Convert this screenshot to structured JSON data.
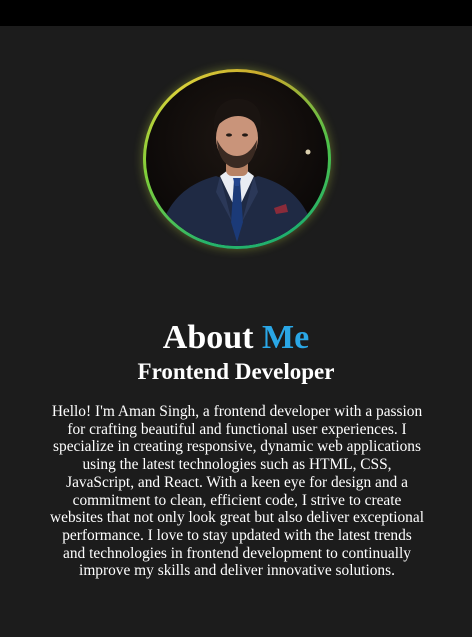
{
  "about": {
    "title_prefix": "About",
    "title_accent": "Me",
    "role": "Frontend Developer",
    "bio": "Hello! I'm Aman Singh, a frontend developer with a passion for crafting beautiful and functional user experiences. I specialize in creating responsive, dynamic web applications using the latest technologies such as HTML, CSS, JavaScript, and React. With a keen eye for design and a commitment to clean, efficient code, I strive to create websites that not only look great but also deliver exceptional performance. I love to stay updated with the latest trends and technologies in frontend development to continually improve my skills and deliver innovative solutions."
  },
  "colors": {
    "accent": "#2aa7e6",
    "background": "#1c1c1c",
    "topbar": "#000000"
  }
}
